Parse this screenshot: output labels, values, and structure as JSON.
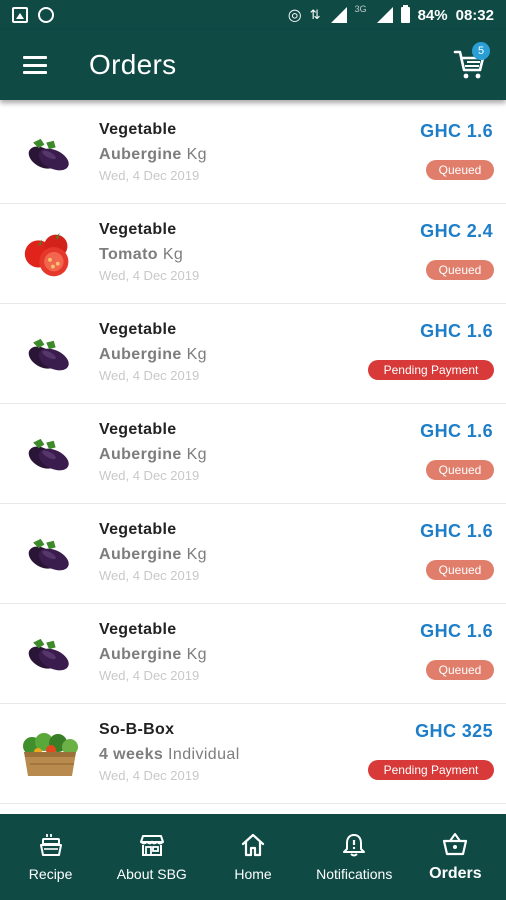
{
  "status_bar": {
    "network_label": "3G",
    "battery": "84%",
    "time": "08:32"
  },
  "app_bar": {
    "title": "Orders",
    "cart_count": "5"
  },
  "orders": [
    {
      "category": "Vegetable",
      "name": "Aubergine",
      "unit": "Kg",
      "date": "Wed, 4 Dec 2019",
      "price": "GHC 1.6",
      "status": "Queued",
      "image": "aubergine"
    },
    {
      "category": "Vegetable",
      "name": "Tomato",
      "unit": "Kg",
      "date": "Wed, 4 Dec 2019",
      "price": "GHC 2.4",
      "status": "Queued",
      "image": "tomato"
    },
    {
      "category": "Vegetable",
      "name": "Aubergine",
      "unit": "Kg",
      "date": "Wed, 4 Dec 2019",
      "price": "GHC 1.6",
      "status": "Pending Payment",
      "image": "aubergine"
    },
    {
      "category": "Vegetable",
      "name": "Aubergine",
      "unit": "Kg",
      "date": "Wed, 4 Dec 2019",
      "price": "GHC 1.6",
      "status": "Queued",
      "image": "aubergine"
    },
    {
      "category": "Vegetable",
      "name": "Aubergine",
      "unit": "Kg",
      "date": "Wed, 4 Dec 2019",
      "price": "GHC 1.6",
      "status": "Queued",
      "image": "aubergine"
    },
    {
      "category": "Vegetable",
      "name": "Aubergine",
      "unit": "Kg",
      "date": "Wed, 4 Dec 2019",
      "price": "GHC 1.6",
      "status": "Queued",
      "image": "aubergine"
    },
    {
      "category": "So-B-Box",
      "name": "4 weeks",
      "unit": "Individual",
      "date": "Wed, 4 Dec 2019",
      "price": "GHC 325",
      "status": "Pending Payment",
      "image": "vegetable-box"
    }
  ],
  "bottom_nav": {
    "recipe": "Recipe",
    "about": "About SBG",
    "home": "Home",
    "notifications": "Notifications",
    "orders": "Orders"
  },
  "colors": {
    "primary": "#0f4a45",
    "price": "#1e7ec8",
    "queued": "#e07e6b",
    "pending": "#d83a3a"
  }
}
